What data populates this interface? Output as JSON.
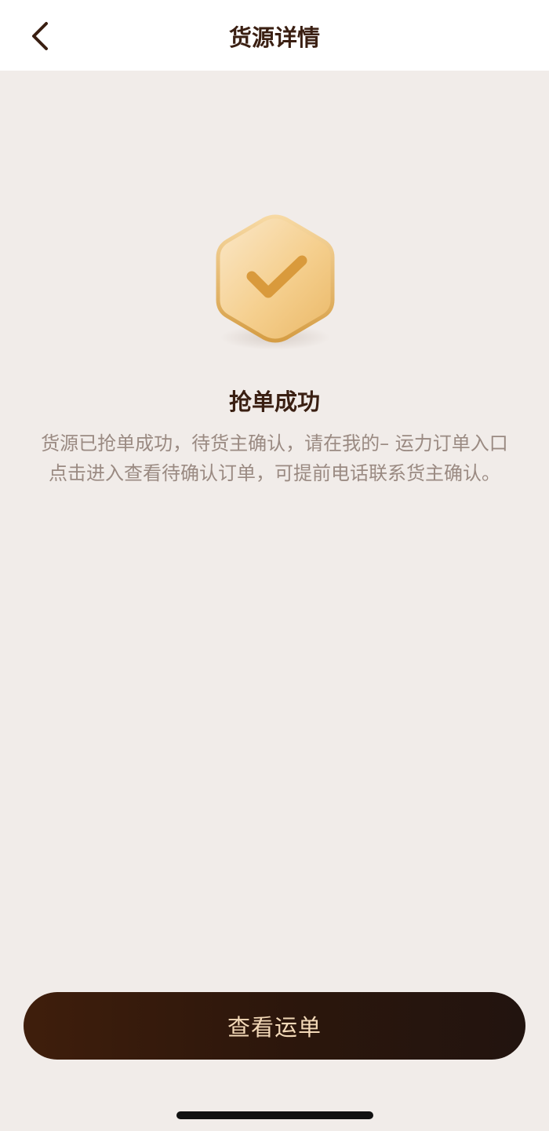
{
  "navbar": {
    "title": "货源详情",
    "back_icon": "chevron-left-icon"
  },
  "result": {
    "icon": "hexagon-check-icon",
    "title": "抢单成功",
    "description": "货源已抢单成功，待货主确认，请在我的– 运力订单入口点击进入查看待确认订单，可提前电话联系货主确认。"
  },
  "action": {
    "view_waybill_label": "查看运单"
  },
  "colors": {
    "accent_dark": "#3f1e0c",
    "button_text": "#f3d9b8",
    "badge_gold": "#e9b96a",
    "background": "#f1ece9"
  }
}
